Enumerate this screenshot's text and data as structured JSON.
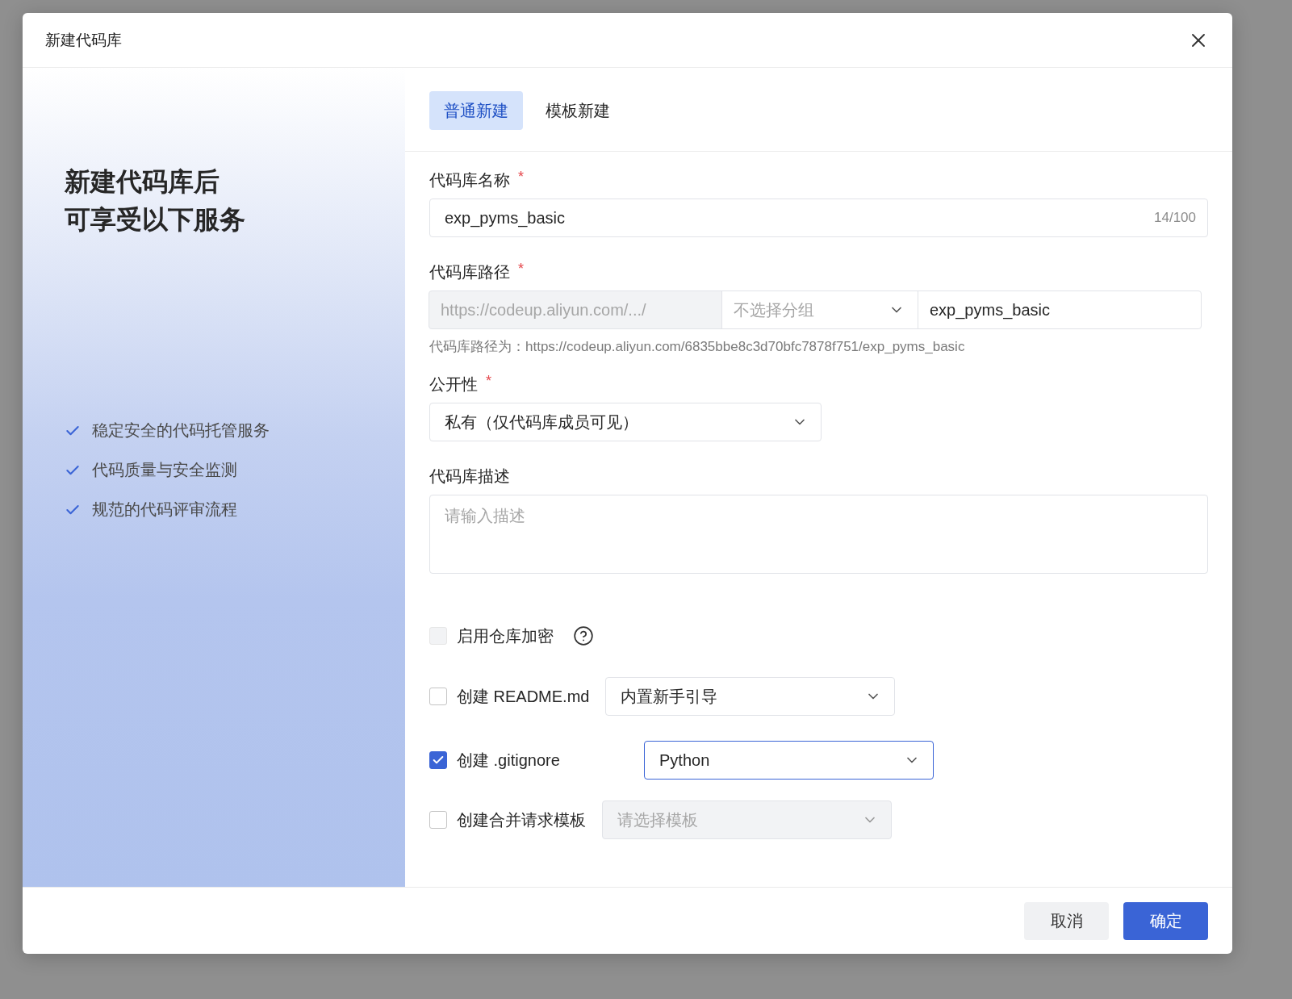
{
  "dialog": {
    "title": "新建代码库"
  },
  "promo": {
    "heading_lines": [
      "新建代码库后",
      "可享受以下服务"
    ],
    "features": [
      "稳定安全的代码托管服务",
      "代码质量与安全监测",
      "规范的代码评审流程"
    ]
  },
  "tabs": [
    {
      "label": "普通新建",
      "selected": true
    },
    {
      "label": "模板新建",
      "selected": false
    }
  ],
  "form": {
    "name": {
      "label": "代码库名称",
      "required_mark": "*",
      "value": "exp_pyms_basic",
      "counter": "14/100"
    },
    "path": {
      "label": "代码库路径",
      "required_mark": "*",
      "prefix": "https://codeup.aliyun.com/.../",
      "group_placeholder": "不选择分组",
      "value": "exp_pyms_basic",
      "hint": "代码库路径为：https://codeup.aliyun.com/6835bbe8c3d70bfc7878f751/exp_pyms_basic"
    },
    "visibility": {
      "label": "公开性",
      "required_mark": "*",
      "value": "私有（仅代码库成员可见）"
    },
    "description": {
      "label": "代码库描述",
      "placeholder": "请输入描述"
    },
    "options": [
      {
        "kind": "help",
        "label": "启用仓库加密",
        "checked": false,
        "disabled": true
      },
      {
        "kind": "select",
        "label": "创建 README.md",
        "checked": false,
        "value": "内置新手引导",
        "focused": false,
        "select_disabled": false
      },
      {
        "kind": "select",
        "label": "创建 .gitignore",
        "checked": true,
        "value": "Python",
        "focused": true,
        "select_disabled": false
      },
      {
        "kind": "select",
        "label": "创建合并请求模板",
        "checked": false,
        "placeholder": "请选择模板",
        "focused": false,
        "select_disabled": true
      }
    ]
  },
  "buttons": [
    {
      "kind": "secondary",
      "label": "取消"
    },
    {
      "kind": "primary",
      "label": "确定"
    }
  ]
}
